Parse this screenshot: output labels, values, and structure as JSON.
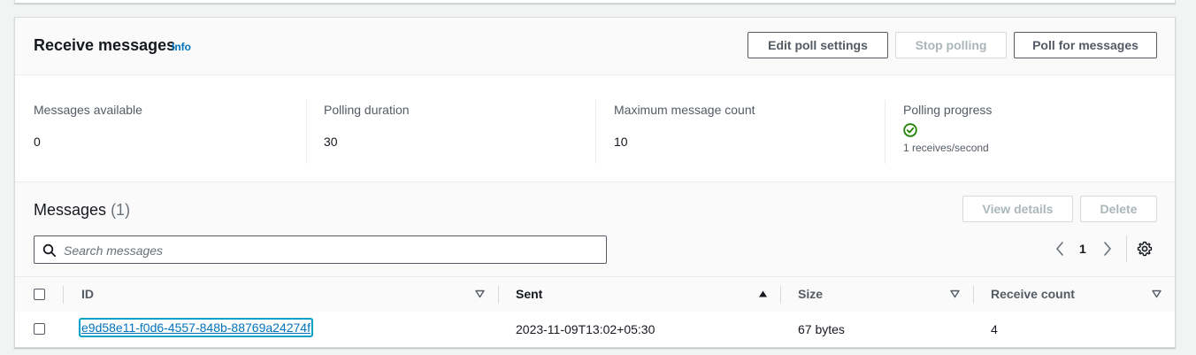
{
  "receive": {
    "title": "Receive messages",
    "info_link": "Info",
    "buttons": {
      "edit_poll": "Edit poll settings",
      "stop_polling": "Stop polling",
      "poll_for_messages": "Poll for messages"
    }
  },
  "stats": {
    "messages_available": {
      "label": "Messages available",
      "value": "0"
    },
    "polling_duration": {
      "label": "Polling duration",
      "value": "30"
    },
    "max_message_count": {
      "label": "Maximum message count",
      "value": "10"
    },
    "polling_progress": {
      "label": "Polling progress",
      "rate": "1 receives/second",
      "icon": "success-check-icon",
      "progress": 1.0
    }
  },
  "messages": {
    "title": "Messages",
    "count": "(1)",
    "buttons": {
      "view_details": "View details",
      "delete": "Delete"
    },
    "search_placeholder": "Search messages",
    "page": "1",
    "columns": [
      "ID",
      "Sent",
      "Size",
      "Receive count"
    ],
    "rows": [
      {
        "id": "e9d58e11-f0d6-4557-848b-88769a24274f",
        "sent": "2023-11-09T13:02+05:30",
        "size": "67 bytes",
        "receive_count": "4"
      }
    ]
  },
  "colors": {
    "accent_link": "#0073bb",
    "focus_ring": "#00a1c9",
    "success": "#1d8102",
    "text": "#16191f",
    "muted": "#545b64"
  }
}
